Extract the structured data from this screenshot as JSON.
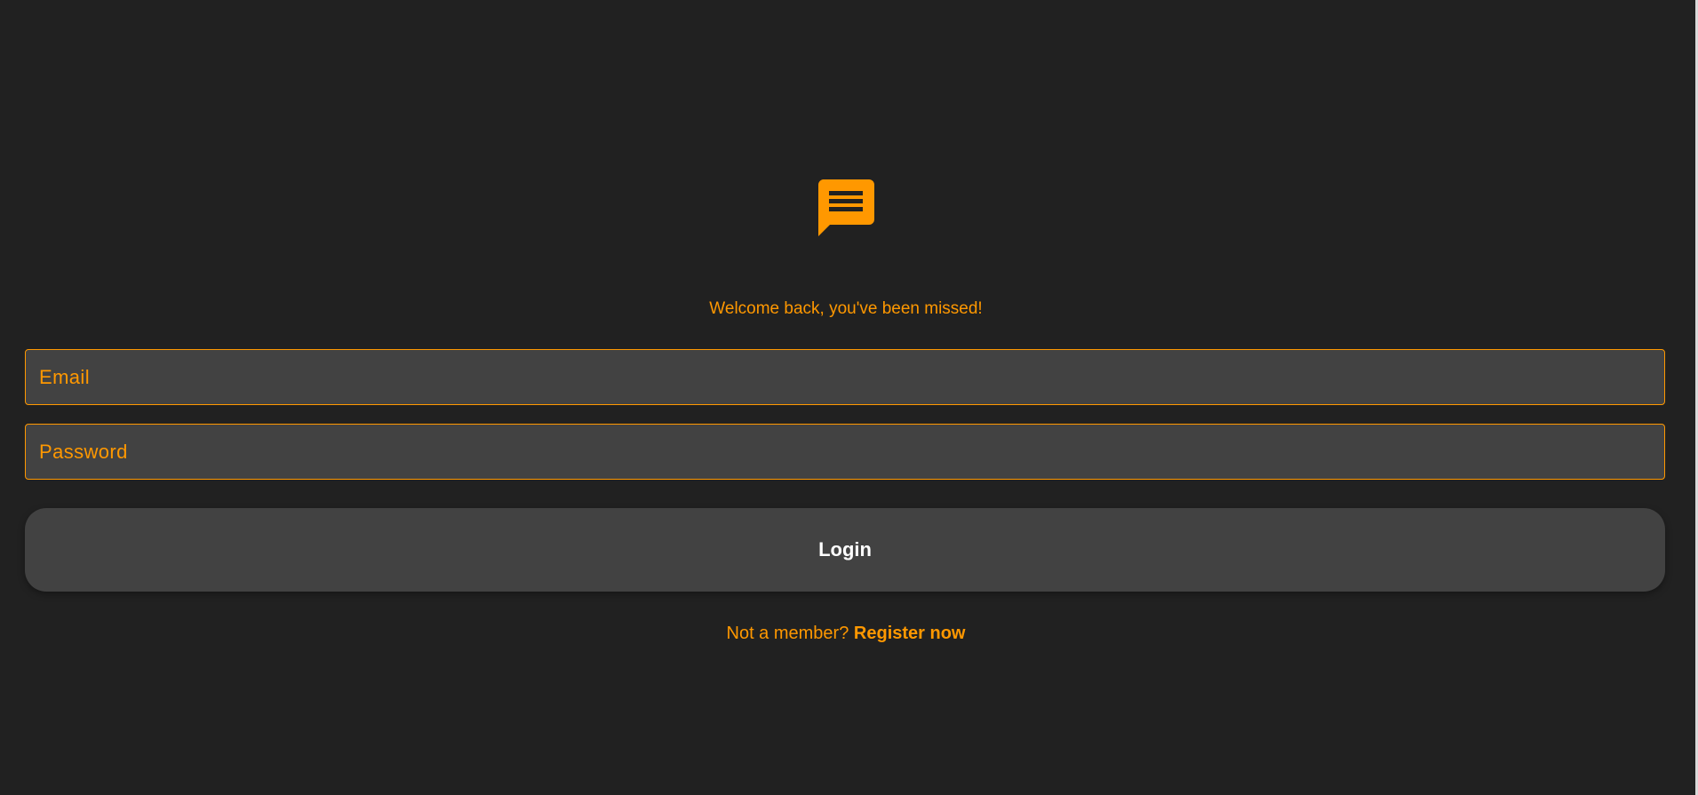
{
  "brand": {
    "logo_icon": "chat-bubble-icon",
    "accent_color": "#ff9800",
    "background_color": "#212121",
    "surface_color": "#424242"
  },
  "welcome": {
    "text": "Welcome back, you've been missed!"
  },
  "form": {
    "email": {
      "value": "",
      "placeholder": "Email"
    },
    "password": {
      "value": "",
      "placeholder": "Password"
    },
    "login_label": "Login"
  },
  "register": {
    "prompt": "Not a member?",
    "link_label": "Register now"
  }
}
